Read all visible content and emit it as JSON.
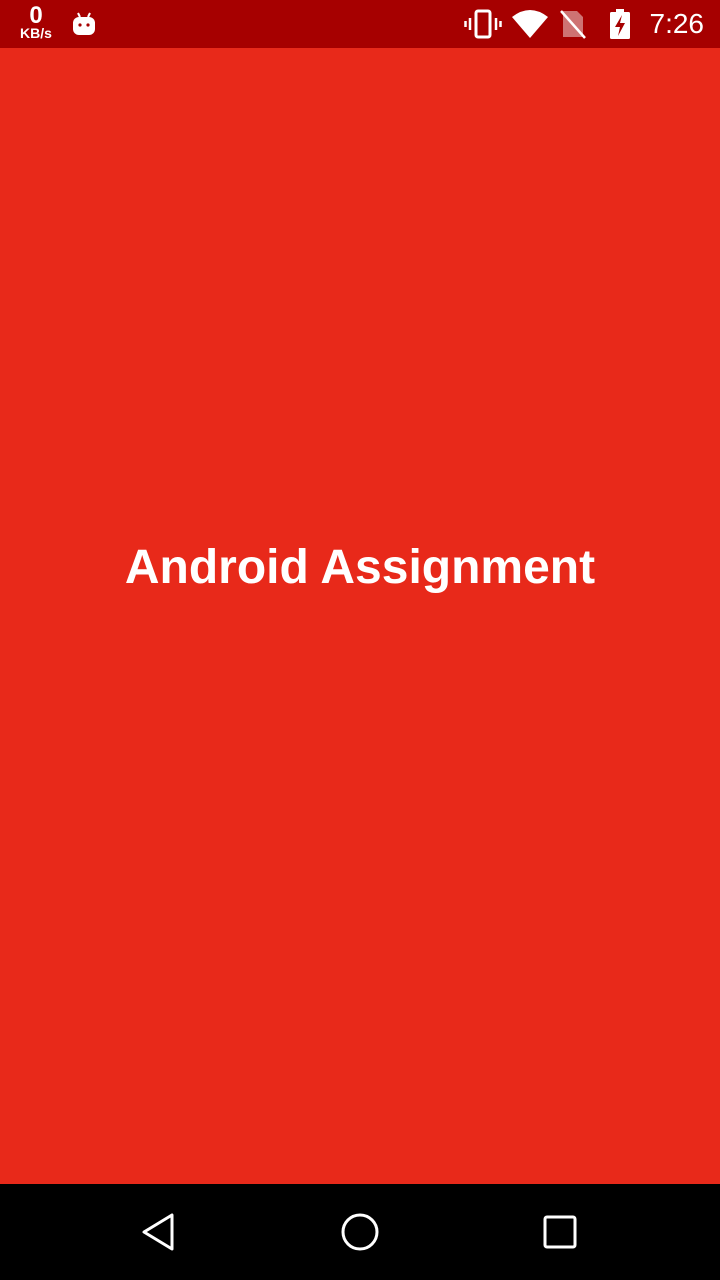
{
  "status_bar": {
    "net_speed_value": "0",
    "net_speed_unit": "KB/s",
    "time": "7:26",
    "icons": [
      "android-debug-icon",
      "vibrate-icon",
      "wifi-icon",
      "no-sim-icon",
      "battery-charging-icon"
    ]
  },
  "main": {
    "title": "Android Assignment"
  },
  "nav_bar": {
    "buttons": [
      "back-icon",
      "home-icon",
      "recents-icon"
    ]
  },
  "colors": {
    "background": "#e8291a",
    "status_bar": "#a60000",
    "nav_bar": "#000000",
    "text": "#ffffff"
  }
}
